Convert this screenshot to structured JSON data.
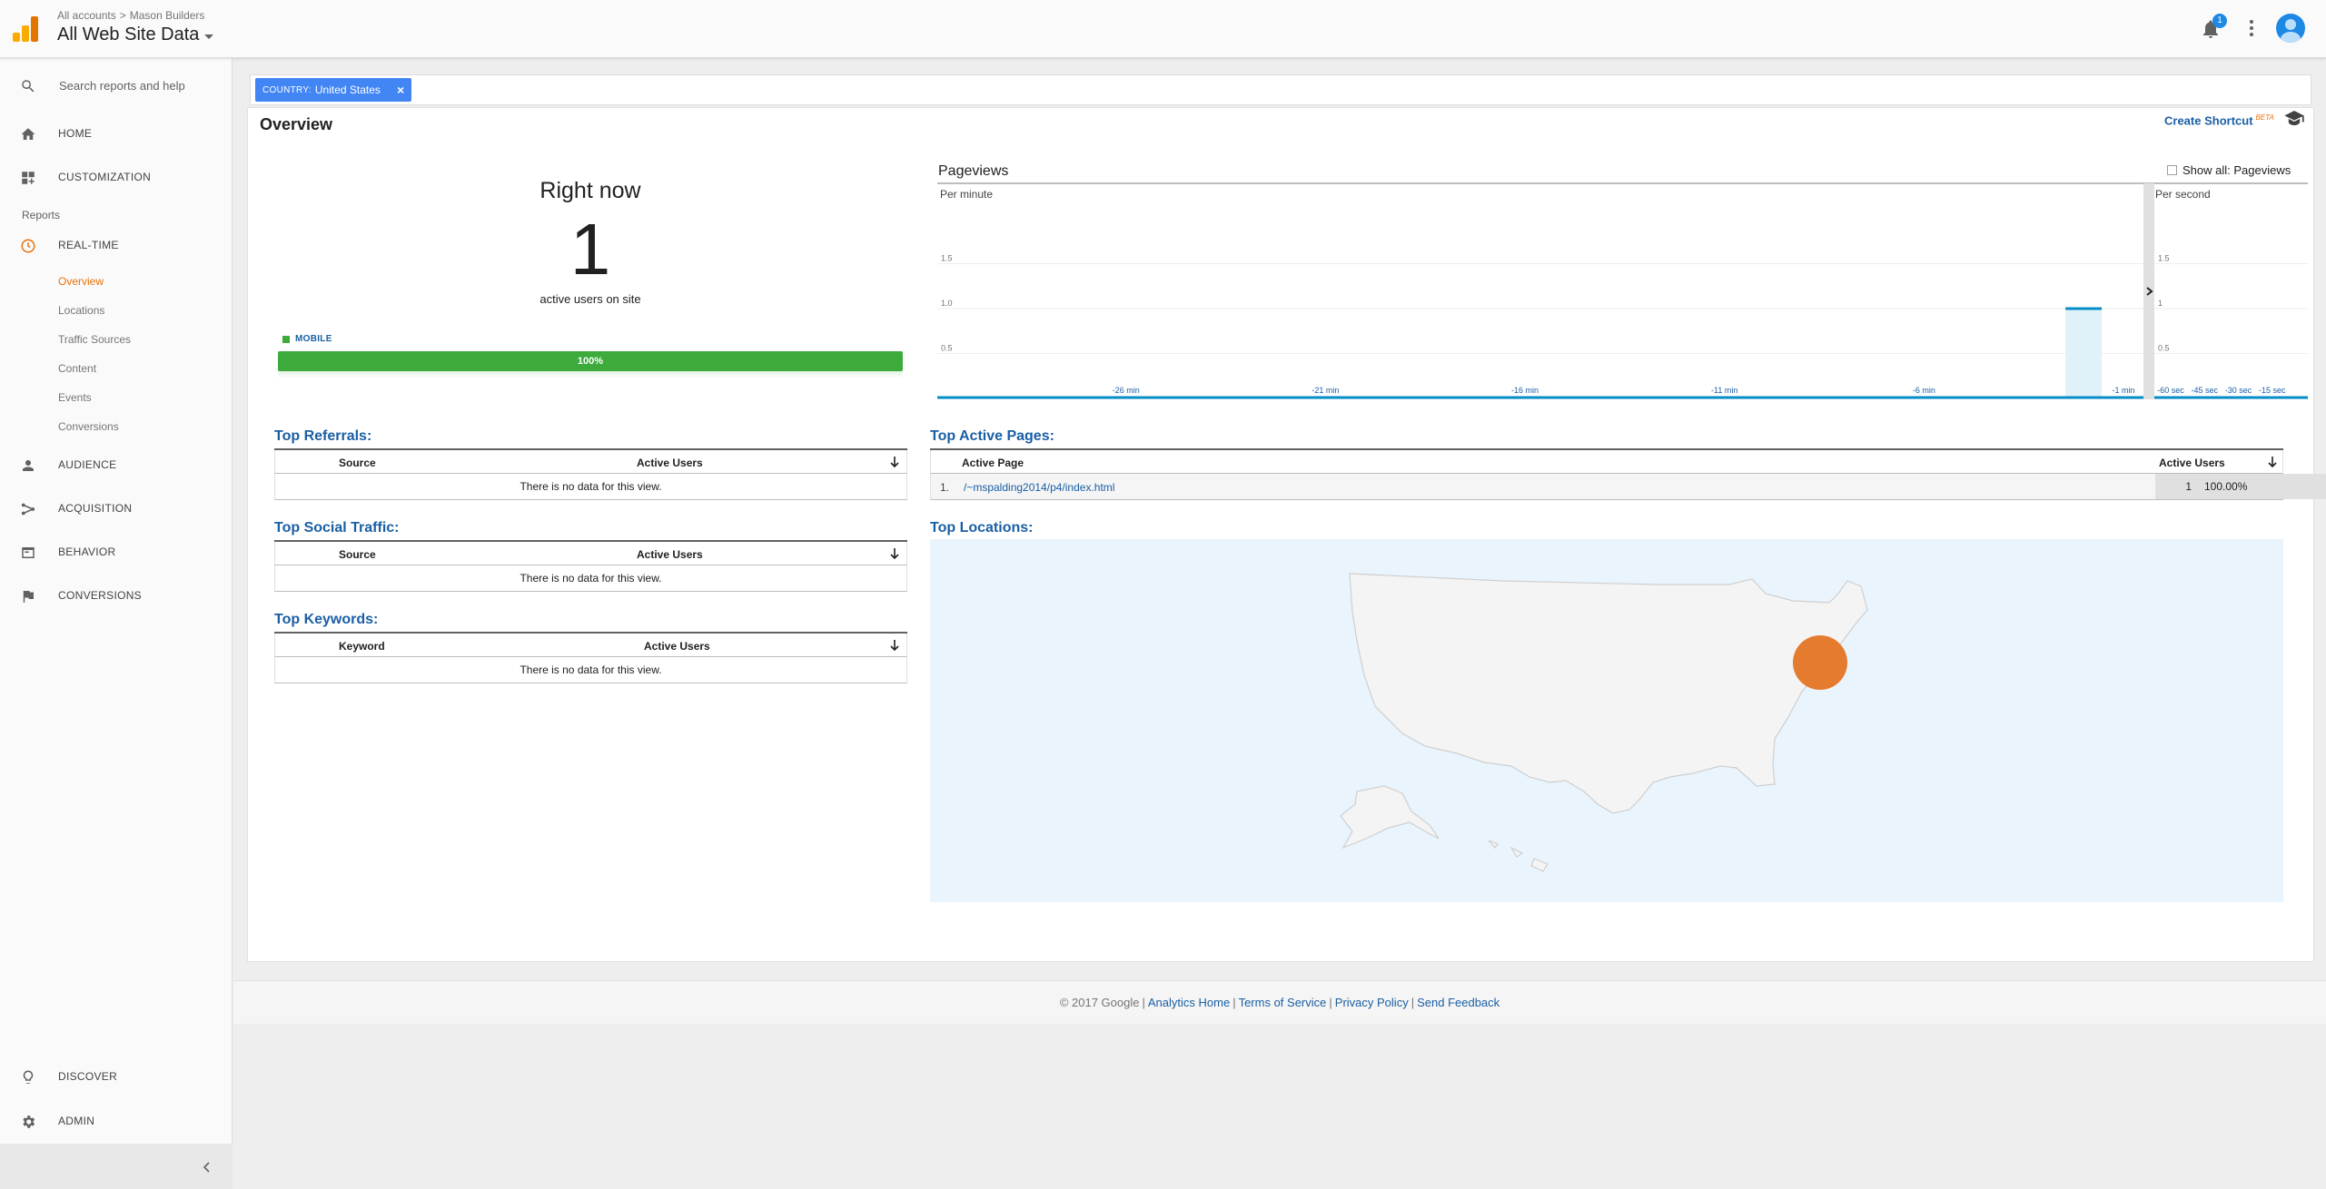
{
  "header": {
    "breadcrumbs": [
      "All accounts",
      "Mason Builders"
    ],
    "breadcrumb_sep": ">",
    "property": "All Web Site Data",
    "notifications_count": "1",
    "icons": [
      "analytics-logo",
      "bell-icon",
      "more-vert-icon",
      "account-avatar-icon"
    ]
  },
  "sidebar": {
    "search_label": "Search reports and help",
    "home": "HOME",
    "customization": "CUSTOMIZATION",
    "reports_label": "Reports",
    "realtime": "REAL-TIME",
    "realtime_items": [
      "Overview",
      "Locations",
      "Traffic Sources",
      "Content",
      "Events",
      "Conversions"
    ],
    "active_item": "Overview",
    "audience": "AUDIENCE",
    "acquisition": "ACQUISITION",
    "behavior": "BEHAVIOR",
    "conversions": "CONVERSIONS",
    "discover": "DISCOVER",
    "admin": "ADMIN"
  },
  "filter": {
    "key": "COUNTRY:",
    "value": "United States",
    "remove": "×"
  },
  "overview": {
    "title": "Overview",
    "create_shortcut": "Create Shortcut",
    "beta": "BETA",
    "right_now_title": "Right now",
    "active_users": "1",
    "active_users_caption": "active users on site",
    "device_label": "MOBILE",
    "device_percent_label": "100%",
    "device_share": 1.0
  },
  "pageviews": {
    "title": "Pageviews",
    "show_all": "Show all: Pageviews",
    "per_minute": "Per minute",
    "per_second": "Per second"
  },
  "chart_data": [
    {
      "type": "bar",
      "title": "Per minute",
      "y_ticks": [
        "0.5",
        "1.0",
        "1.5"
      ],
      "ylim": [
        0,
        2
      ],
      "x_ticks": [
        "-26 min",
        "-21 min",
        "-16 min",
        "-11 min",
        "-6 min",
        "-1 min"
      ],
      "x_minutes": [
        -30,
        -29,
        -28,
        -27,
        -26,
        -25,
        -24,
        -23,
        -22,
        -21,
        -20,
        -19,
        -18,
        -17,
        -16,
        -15,
        -14,
        -13,
        -12,
        -11,
        -10,
        -9,
        -8,
        -7,
        -6,
        -5,
        -4,
        -3,
        -2,
        -1
      ],
      "values": [
        0,
        0,
        0,
        0,
        0,
        0,
        0,
        0,
        0,
        0,
        0,
        0,
        0,
        0,
        0,
        0,
        0,
        0,
        0,
        0,
        0,
        0,
        0,
        0,
        0,
        0,
        0,
        0,
        1,
        0
      ]
    },
    {
      "type": "bar",
      "title": "Per second",
      "y_ticks": [
        "0.5",
        "1",
        "1.5"
      ],
      "ylim": [
        0,
        2
      ],
      "x_ticks": [
        "-60 sec",
        "-45 sec",
        "-30 sec",
        "-15 sec"
      ],
      "values": []
    }
  ],
  "top_referrals": {
    "title": "Top Referrals:",
    "col1": "Source",
    "col2": "Active Users",
    "empty": "There is no data for this view."
  },
  "top_social": {
    "title": "Top Social Traffic:",
    "col1": "Source",
    "col2": "Active Users",
    "empty": "There is no data for this view."
  },
  "top_keywords": {
    "title": "Top Keywords:",
    "col1": "Keyword",
    "col2": "Active Users",
    "empty": "There is no data for this view."
  },
  "top_pages": {
    "title": "Top Active Pages:",
    "col1": "Active Page",
    "col2": "Active Users",
    "rows": [
      {
        "num": "1.",
        "page": "/~mspalding2014/p4/index.html",
        "users": "1",
        "percent": "100.00%"
      }
    ]
  },
  "top_locations": {
    "title": "Top Locations:",
    "marker_color": "#e57b2e"
  },
  "footer": {
    "copyright": "© 2017 Google",
    "links": [
      "Analytics Home",
      "Terms of Service",
      "Privacy Policy",
      "Send Feedback"
    ],
    "sep": "|"
  },
  "colors": {
    "accent_orange": "#e8710a",
    "link_blue": "#1a5fa4",
    "chip_blue": "#4285f4",
    "mobile_green": "#3cab3c"
  }
}
